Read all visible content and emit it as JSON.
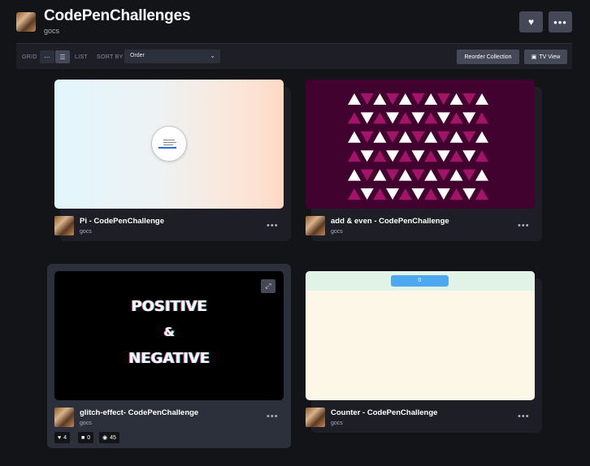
{
  "header": {
    "title": "CodePenChallenges",
    "owner": "gocs",
    "heart_icon": "heart-icon",
    "more_icon": "more-icon"
  },
  "toolbar": {
    "grid_label": "GRID",
    "list_label": "LIST",
    "sort_label": "SORT BY",
    "sort_value": "Order",
    "reorder_label": "Reorder Collection",
    "tv_label": "TV View"
  },
  "cards": [
    {
      "title": "Pi - CodePenChallenge",
      "owner": "gocs",
      "preview": "pi"
    },
    {
      "title": "add & even - CodePenChallenge",
      "owner": "gocs",
      "preview": "triangles"
    },
    {
      "title": "glitch-effect- CodePenChallenge",
      "owner": "gocs",
      "preview": "glitch",
      "glitch_line1": "POSITIVE",
      "glitch_line2": "&",
      "glitch_line3": "NEGATIVE",
      "stats": {
        "likes": "4",
        "comments": "0",
        "views": "45"
      }
    },
    {
      "title": "Counter - CodePenChallenge",
      "owner": "gocs",
      "preview": "counter",
      "counter_value": "0"
    }
  ],
  "colors": {
    "background": "#131417",
    "card": "#1e1f26",
    "button": "#444857",
    "triangle_bg": "#420230",
    "triangle_magenta": "#a31469",
    "counter_button": "#4ea8f0"
  }
}
